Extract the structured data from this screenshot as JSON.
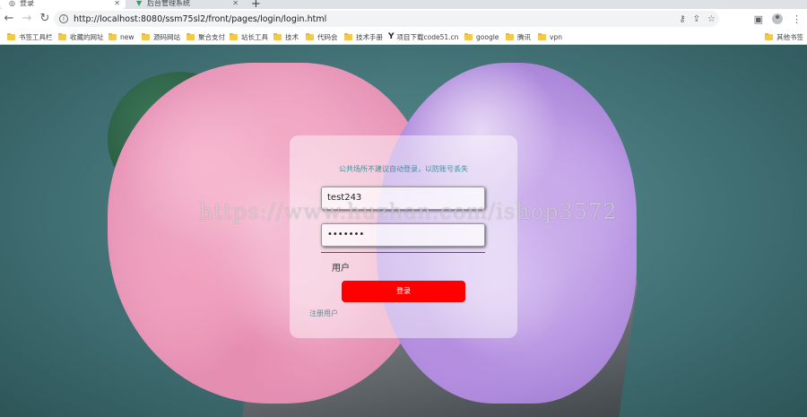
{
  "tabs": [
    {
      "title": "登录",
      "active": true
    },
    {
      "title": "后台管理系统",
      "active": false
    }
  ],
  "address_bar": {
    "url": "http://localhost:8080/ssm75sl2/front/pages/login/login.html"
  },
  "bookmarks": [
    {
      "label": "书签工具栏"
    },
    {
      "label": "收藏的网址"
    },
    {
      "label": "new"
    },
    {
      "label": "源码网站"
    },
    {
      "label": "聚合支付"
    },
    {
      "label": "站长工具"
    },
    {
      "label": "技术"
    },
    {
      "label": "代码会"
    },
    {
      "label": "技术手册"
    },
    {
      "label": "项目下载code51.cn"
    },
    {
      "label": "google"
    },
    {
      "label": "腾讯"
    },
    {
      "label": "vpn"
    },
    {
      "label": "其他书签"
    }
  ],
  "login": {
    "tip": "公共场所不建议自动登录，以防账号丢失",
    "username_value": "test243",
    "password_value": "•••••••",
    "role_label": "用户",
    "login_button": "登录",
    "register_link": "注册用户"
  },
  "watermark": "https://www.huzhan.com/ishop3572",
  "colors": {
    "login_button": "#ff0000",
    "tip_text": "#3e8fa0",
    "background": "#47787c"
  }
}
